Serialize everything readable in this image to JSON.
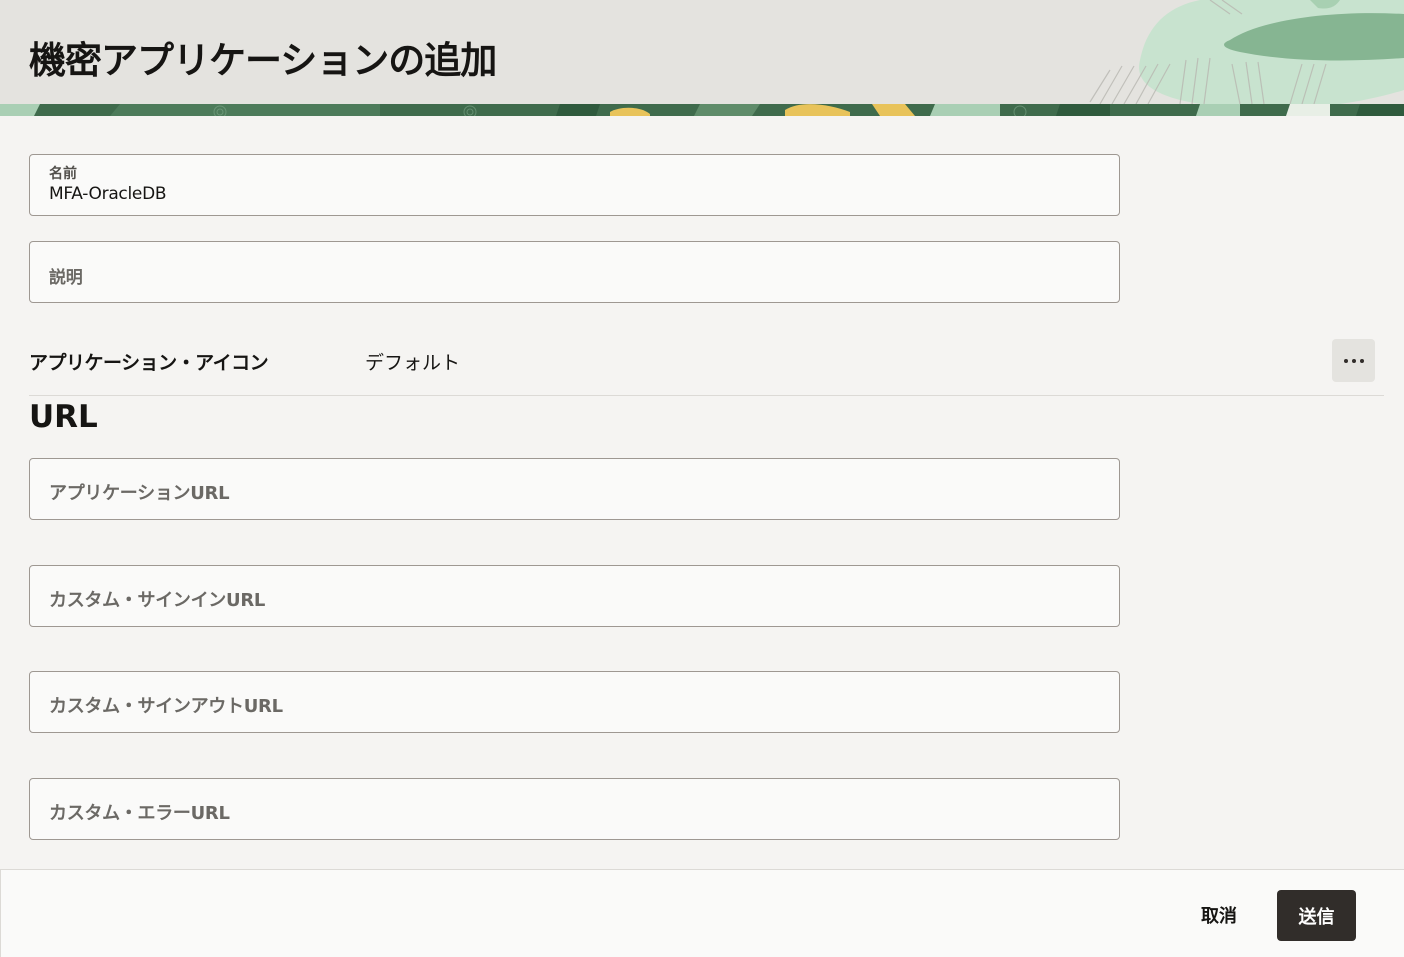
{
  "header": {
    "title": "機密アプリケーションの追加"
  },
  "form": {
    "name": {
      "label": "名前",
      "value": "MFA-OracleDB"
    },
    "description": {
      "placeholder": "説明"
    },
    "app_icon": {
      "label": "アプリケーション・アイコン",
      "value": "デフォルト",
      "more_icon": "ellipsis-icon"
    }
  },
  "url_section": {
    "heading": "URL",
    "fields": [
      {
        "placeholder": "アプリケーションURL"
      },
      {
        "placeholder": "カスタム・サインインURL"
      },
      {
        "placeholder": "カスタム・サインアウトURL"
      },
      {
        "placeholder": "カスタム・エラーURL"
      }
    ]
  },
  "footer": {
    "cancel_label": "取消",
    "submit_label": "送信"
  },
  "colors": {
    "header_bg": "#e4e3df",
    "page_bg": "#f5f4f2",
    "primary_button": "#312d2a",
    "accent_green": "#3f7a52",
    "accent_yellow": "#e8c35a"
  }
}
